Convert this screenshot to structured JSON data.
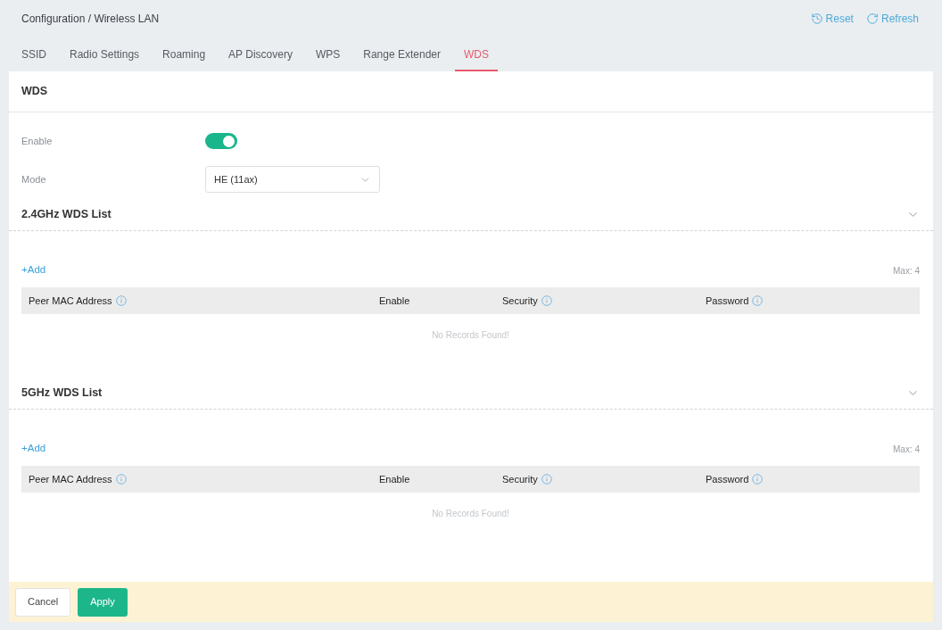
{
  "breadcrumb": "Configuration / Wireless LAN",
  "actions": [
    {
      "kind": "reset",
      "label": "Reset"
    },
    {
      "kind": "refresh",
      "label": "Refresh"
    }
  ],
  "tabs": [
    {
      "label": "SSID",
      "selected": false
    },
    {
      "label": "Radio Settings",
      "selected": false
    },
    {
      "label": "Roaming",
      "selected": false
    },
    {
      "label": "AP Discovery",
      "selected": false
    },
    {
      "label": "WPS",
      "selected": false
    },
    {
      "label": "Range Extender",
      "selected": false
    },
    {
      "label": "WDS",
      "selected": true
    }
  ],
  "panel": {
    "title": "WDS",
    "fields": [
      {
        "kind": "toggle",
        "label": "Enable",
        "on": true
      },
      {
        "kind": "select",
        "label": "Mode",
        "value": "HE (11ax)"
      }
    ]
  },
  "lists": [
    {
      "title": "2.4GHz WDS List",
      "expanded": true,
      "add_label": "+Add",
      "limit": "Max: 4",
      "columns": [
        {
          "label": "Peer MAC Address",
          "info": true
        },
        {
          "label": "Enable",
          "info": false
        },
        {
          "label": "Security",
          "info": true
        },
        {
          "label": "Password",
          "info": true
        }
      ],
      "empty_text": "No Records Found!"
    },
    {
      "title": "5GHz WDS List",
      "expanded": true,
      "add_label": "+Add",
      "limit": "Max: 4",
      "columns": [
        {
          "label": "Peer MAC Address",
          "info": true
        },
        {
          "label": "Enable",
          "info": false
        },
        {
          "label": "Security",
          "info": true
        },
        {
          "label": "Password",
          "info": true
        }
      ],
      "empty_text": "No Records Found!"
    }
  ],
  "footer": {
    "buttons": [
      {
        "kind": "secondary",
        "label": "Cancel"
      },
      {
        "kind": "primary",
        "label": "Apply"
      }
    ]
  }
}
